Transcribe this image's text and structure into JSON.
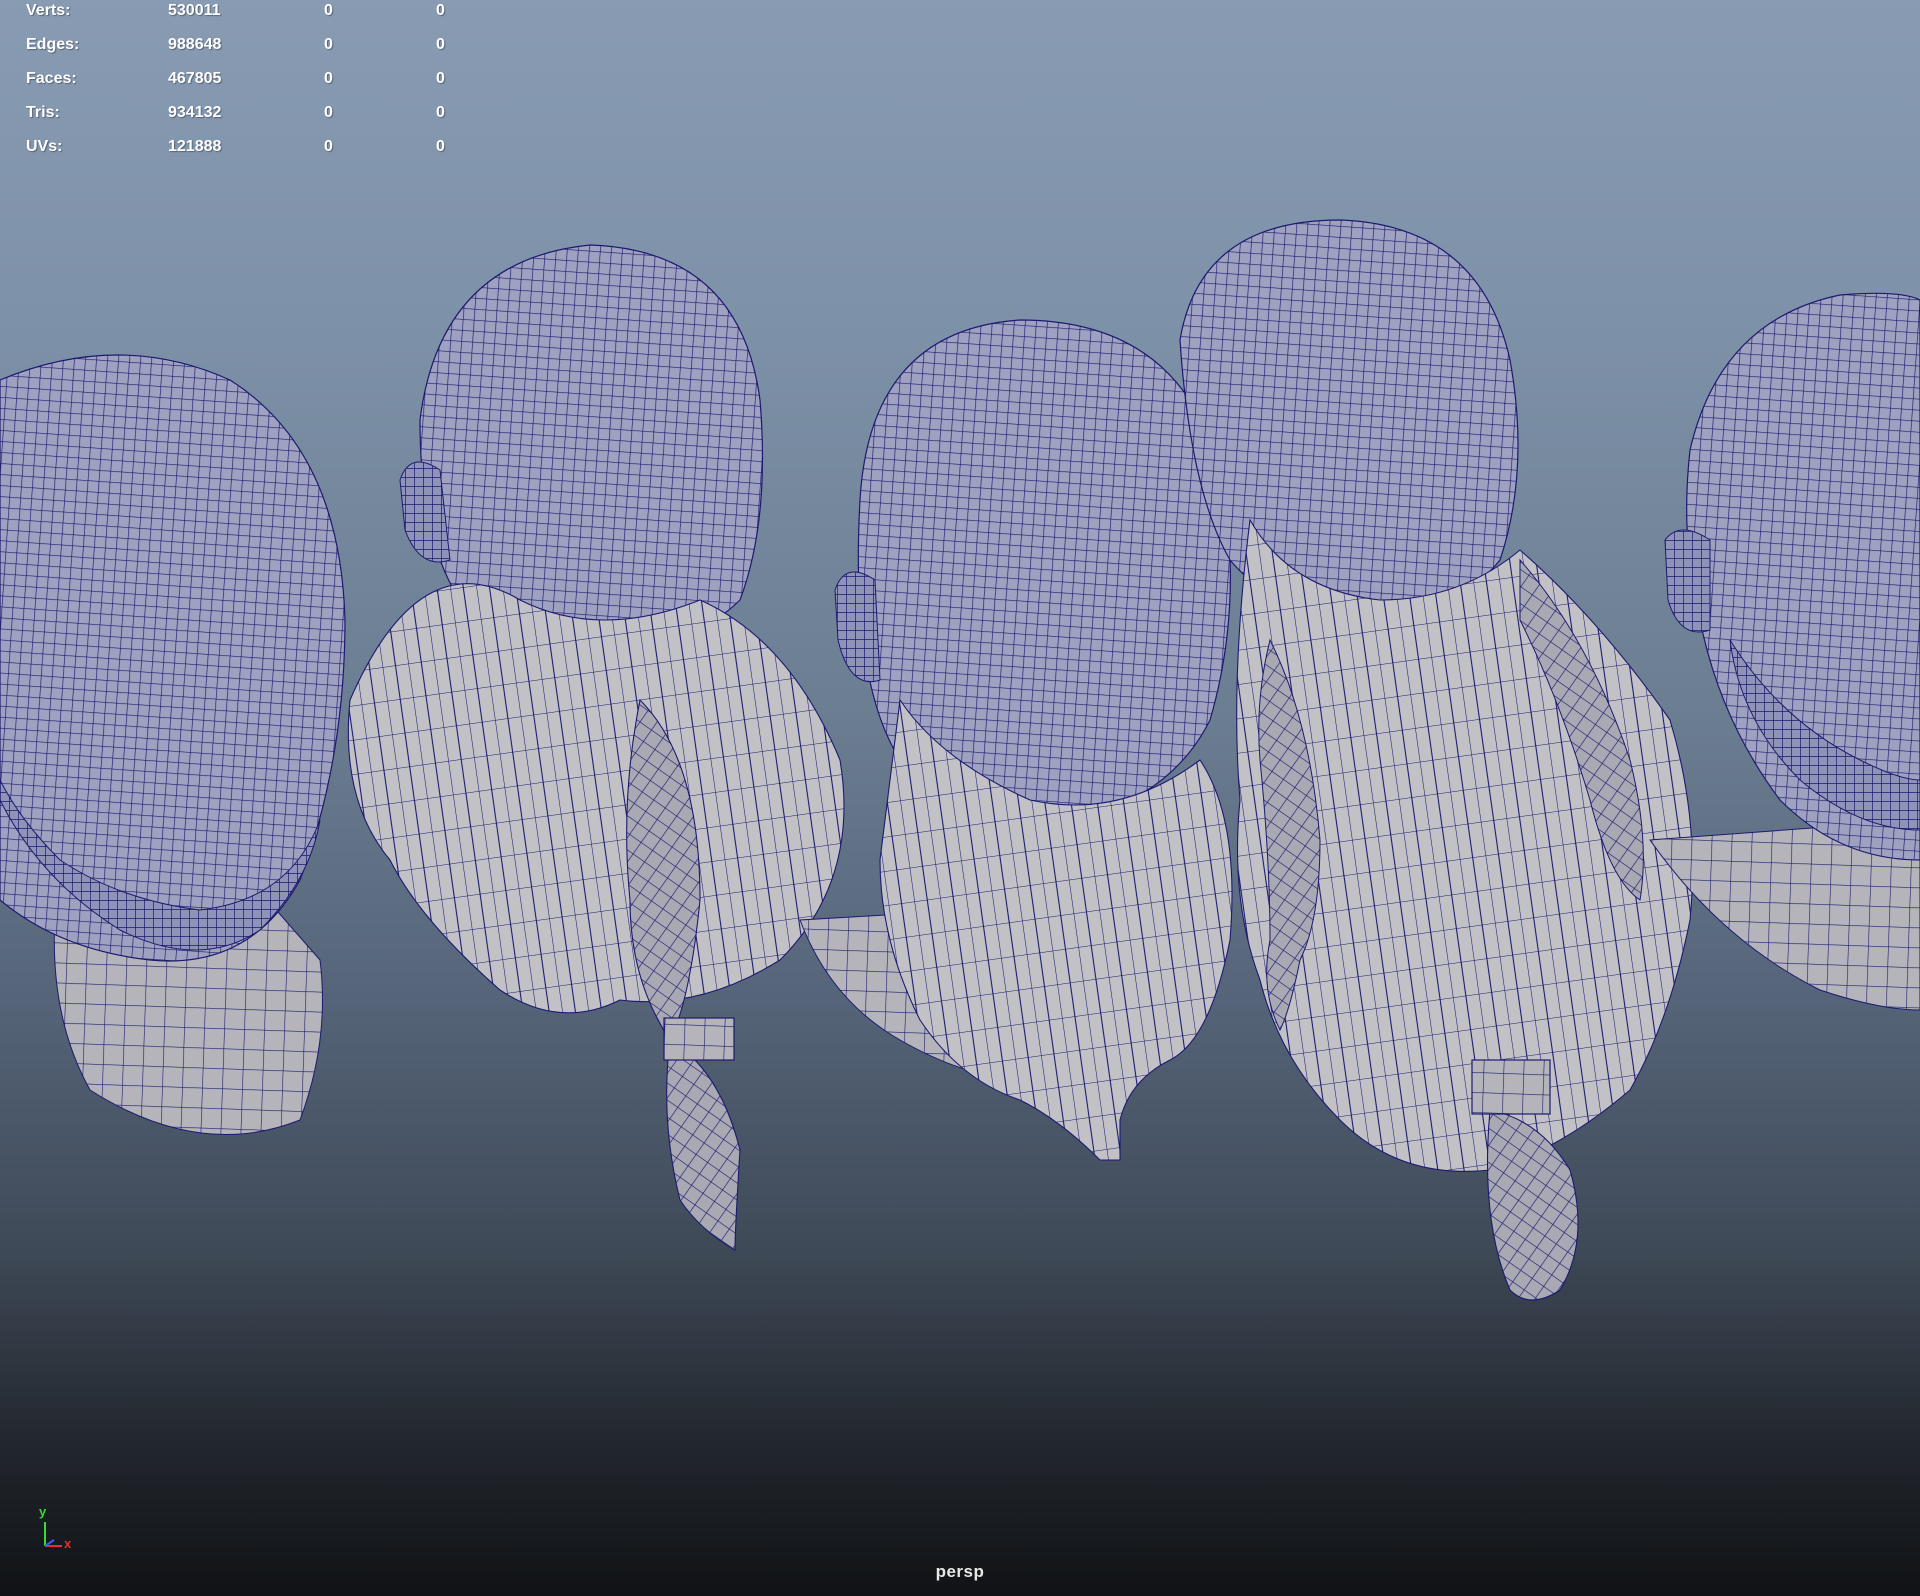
{
  "hud": {
    "rows": [
      {
        "label": "Verts:",
        "v1": "530011",
        "v2": "0",
        "v3": "0"
      },
      {
        "label": "Edges:",
        "v1": "988648",
        "v2": "0",
        "v3": "0"
      },
      {
        "label": "Faces:",
        "v1": "467805",
        "v2": "0",
        "v3": "0"
      },
      {
        "label": "Tris:",
        "v1": "934132",
        "v2": "0",
        "v3": "0"
      },
      {
        "label": "UVs:",
        "v1": "121888",
        "v2": "0",
        "v3": "0"
      }
    ]
  },
  "viewport": {
    "camera": "persp",
    "axis": {
      "y": "y",
      "x": "x"
    }
  },
  "colors": {
    "wire": "#1c1a70",
    "mesh_fill": "#b7b7bb",
    "axis_y": "#33dd33",
    "axis_x": "#e03030",
    "axis_z": "#3060ff"
  }
}
